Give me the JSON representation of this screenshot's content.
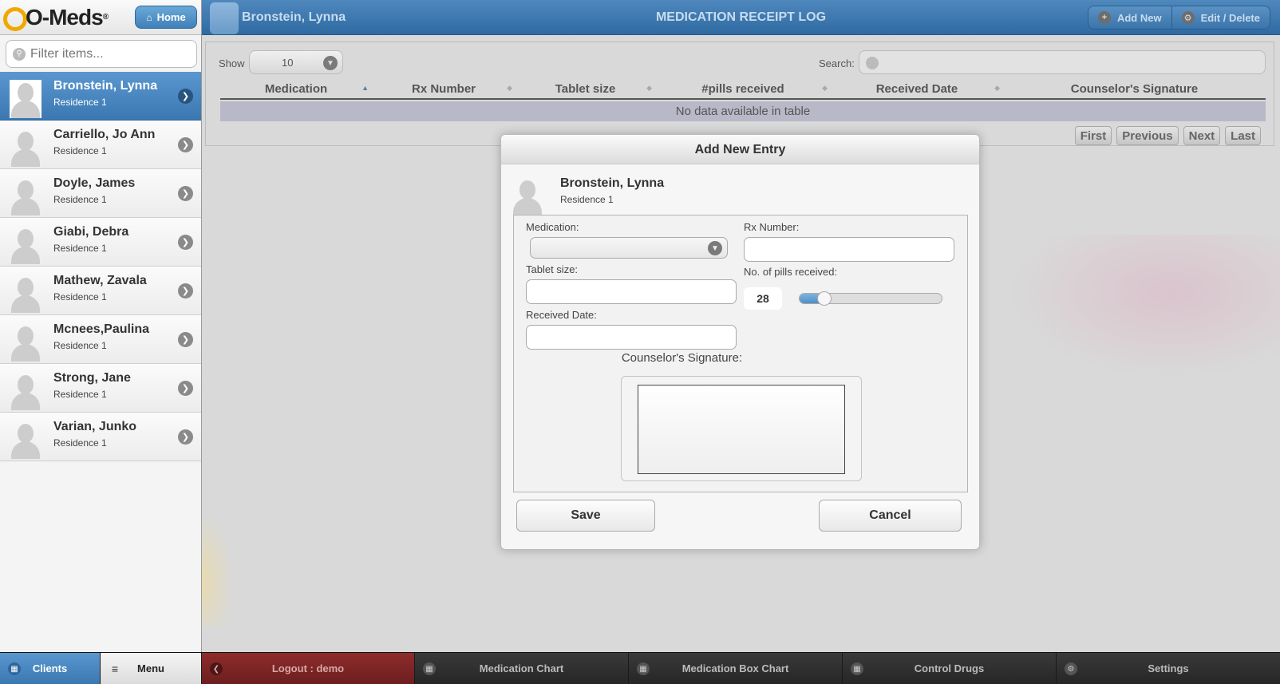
{
  "app": {
    "logo_text": "O-Meds",
    "logo_reg": "®",
    "home_label": "Home",
    "filter_placeholder": "Filter items..."
  },
  "clients": [
    {
      "name": "Bronstein, Lynna",
      "residence": "Residence 1",
      "active": true
    },
    {
      "name": "Carriello, Jo Ann",
      "residence": "Residence 1"
    },
    {
      "name": "Doyle, James",
      "residence": "Residence 1"
    },
    {
      "name": "Giabi, Debra",
      "residence": "Residence 1"
    },
    {
      "name": "Mathew, Zavala",
      "residence": "Residence 1"
    },
    {
      "name": "Mcnees,Paulina",
      "residence": "Residence 1"
    },
    {
      "name": "Strong, Jane",
      "residence": "Residence 1"
    },
    {
      "name": "Varian, Junko",
      "residence": "Residence 1"
    }
  ],
  "header": {
    "client_name": "Bronstein, Lynna",
    "title": "MEDICATION RECEIPT LOG",
    "add_new_label": "Add New",
    "edit_delete_label": "Edit / Delete"
  },
  "table": {
    "show_label": "Show",
    "show_value": "10",
    "search_label": "Search:",
    "columns": [
      "Medication",
      "Rx Number",
      "Tablet size",
      "#pills received",
      "Received Date",
      "Counselor's Signature"
    ],
    "empty_text": "No data available in table",
    "pager": [
      "First",
      "Previous",
      "Next",
      "Last"
    ]
  },
  "dialog": {
    "title": "Add New Entry",
    "client_name": "Bronstein, Lynna",
    "client_residence": "Residence 1",
    "medication_label": "Medication:",
    "medication_value": "",
    "rx_label": "Rx Number:",
    "rx_value": "",
    "tablet_label": "Tablet size:",
    "tablet_value": "",
    "pills_label": "No. of pills received:",
    "pills_value": "28",
    "pills_slider_fraction": 0.14,
    "received_label": "Received Date:",
    "received_value": "",
    "signature_label": "Counselor's Signature:",
    "save_label": "Save",
    "cancel_label": "Cancel"
  },
  "footer": {
    "clients_label": "Clients",
    "menu_label": "Menu",
    "logout_label": "Logout : demo",
    "med_chart_label": "Medication Chart",
    "med_box_label": "Medication Box Chart",
    "control_label": "Control Drugs",
    "settings_label": "Settings"
  },
  "icons": {
    "home": "home-icon",
    "search": "search-icon",
    "chevron": "chevron-right-icon",
    "dropdown": "chevron-down-icon",
    "add": "plus-icon",
    "gear": "gear-icon",
    "grid": "grid-icon",
    "menu": "menu-icon",
    "back": "chevron-left-icon"
  },
  "colors": {
    "accent": "#3b78b2",
    "logout": "#8e2c2c",
    "footer": "#2b2b2b"
  }
}
